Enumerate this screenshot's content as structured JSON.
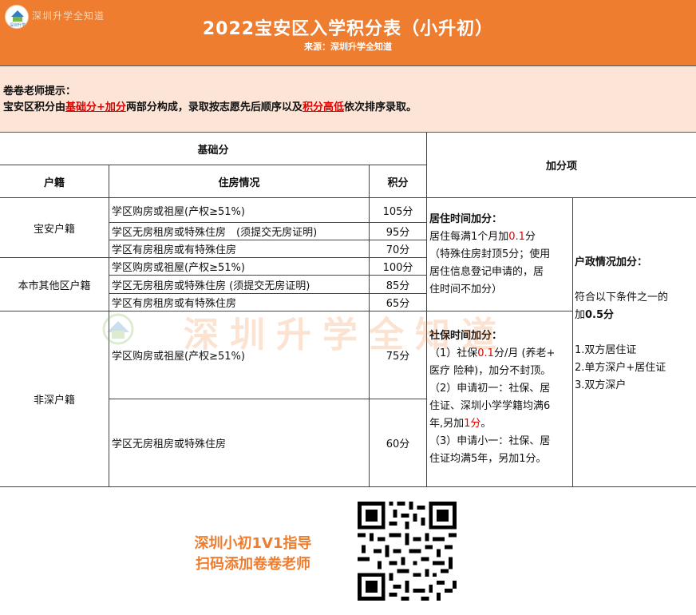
{
  "header": {
    "title": "2022宝安区入学积分表（小升初）",
    "source": "来源：深圳升学全知道",
    "logo_text": "深圳升学全知道",
    "logo_small": "深圳升学"
  },
  "tip": {
    "line1": "卷卷老师提示：",
    "line2_a": "宝安区积分由",
    "line2_em1": "基础分+加分",
    "line2_b": "两部分构成，录取按志愿先后顺序以及",
    "line2_em2": "积分高低",
    "line2_c": "依次排序录取。"
  },
  "table": {
    "base_header": "基础分",
    "bonus_header": "加分项",
    "col_huji": "户籍",
    "col_housing": "住房情况",
    "col_score": "积分",
    "groups": [
      {
        "huji": "宝安户籍",
        "rows": [
          {
            "housing": "学区购房或祖屋(产权≥51%)",
            "score": "105分"
          },
          {
            "housing": "学区无房租房或特殊住房　(须提交无房证明)",
            "score": "95分"
          },
          {
            "housing": "学区有房租房或有特殊住房",
            "score": "70分"
          }
        ]
      },
      {
        "huji": "本市其他区户籍",
        "rows": [
          {
            "housing": "学区购房或祖屋(产权≥51%)",
            "score": "100分"
          },
          {
            "housing": "学区无房租房或特殊住房 (须提交无房证明)",
            "score": "85分"
          },
          {
            "housing": "学区有房租房或有特殊住房",
            "score": "65分"
          }
        ]
      },
      {
        "huji": "非深户籍",
        "rows": [
          {
            "housing": "学区购房或祖屋(产权≥51%)",
            "score": "75分"
          },
          {
            "housing": "学区无房租房或特殊住房",
            "score": "60分"
          }
        ]
      }
    ],
    "residence": {
      "title": "居住时间加分：",
      "l1_a": "居住每满1个月加",
      "l1_red": "0.1",
      "l1_b": "分",
      "l2": "（特殊住房封顶5分；使用",
      "l3": "居住信息登记申请的，居",
      "l4": "住时间不加分）"
    },
    "social": {
      "title": "社保时间加分：",
      "l1_a": "（1）社保",
      "l1_red": "0.1",
      "l1_b": "分/月 (养老+",
      "l2": "医疗 险种)，加分不封顶。",
      "l3": "（2）申请初一：社保、居",
      "l4": "住证、深圳小学学籍均满6",
      "l5_a": "年,另加",
      "l5_red": "1分",
      "l5_b": "。",
      "l6": "（3）申请小一：社保、居",
      "l7": "住证均满5年，另加1分。"
    },
    "household": {
      "title": "户政情况加分：",
      "l1": "符合以下条件之一的",
      "l2_a": "加",
      "l2_b": "0.5分",
      "l3": "1.双方居住证",
      "l4": "2.单方深户+居住证",
      "l5": "3.双方深户"
    }
  },
  "watermark": "深圳升学全知道",
  "footer": {
    "line1": "深圳小初1V1指导",
    "line2": "扫码添加卷卷老师"
  },
  "colors": {
    "header_bg": "#ee7d2f",
    "tip_bg": "#fce4d6",
    "highlight": "#e00000",
    "footer_text": "#ee7d2f"
  }
}
